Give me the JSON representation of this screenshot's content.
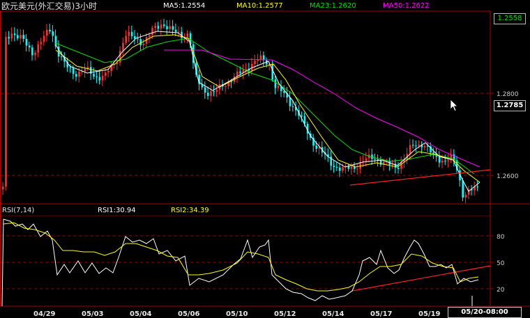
{
  "header": {
    "title": "欧元美元(外汇交易)3小时",
    "ma5": "MA5:1.2554",
    "ma10": "MA10:1.2577",
    "ma23": "MA23:1.2620",
    "ma50": "MA50:1.2622"
  },
  "price_axis": {
    "top_box": "1.2558",
    "level_1280": "1.2800",
    "current_box": "1.2785",
    "level_1260": "1.2600"
  },
  "rsi": {
    "title": "RSI(7,14)",
    "rsi1": "RSI1:30.94",
    "rsi2": "RSI2:34.39",
    "levels": [
      "80",
      "50",
      "20"
    ]
  },
  "x_axis": {
    "dates": [
      "04/29",
      "05/03",
      "05/04",
      "05/06",
      "05/10",
      "05/12",
      "05/14",
      "05/17",
      "05/19"
    ],
    "cursor_date": "05/20-08:00"
  },
  "colors": {
    "background": "#000000",
    "bull": "#ff3030",
    "bear": "#00ffff",
    "ma5": "#ffffff",
    "ma10": "#ffff00",
    "ma23": "#00e000",
    "ma50": "#ff00ff",
    "grid": "#a00000"
  },
  "chart_data": [
    {
      "type": "candlestick",
      "title": "欧元美元(外汇交易)3小时",
      "series": [
        {
          "name": "MA5",
          "value": 1.2554
        },
        {
          "name": "MA10",
          "value": 1.2577
        },
        {
          "name": "MA23",
          "value": 1.262
        },
        {
          "name": "MA50",
          "value": 1.2622
        }
      ],
      "y_tick_labels": [
        1.28,
        1.26
      ],
      "last_price": 1.2785,
      "x_tick_labels": [
        "04/29",
        "05/03",
        "05/04",
        "05/06",
        "05/10",
        "05/12",
        "05/14",
        "05/17",
        "05/19"
      ],
      "grid": true
    },
    {
      "type": "line",
      "title": "RSI(7,14)",
      "series": [
        {
          "name": "RSI1",
          "value": 30.94
        },
        {
          "name": "RSI2",
          "value": 34.39
        }
      ],
      "y_tick_labels": [
        80,
        50,
        20
      ]
    }
  ]
}
